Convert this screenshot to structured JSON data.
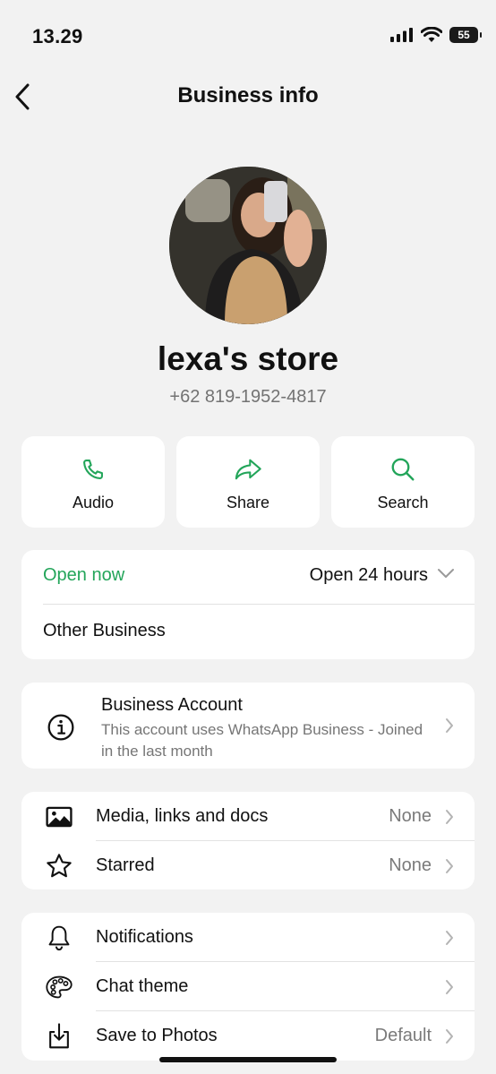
{
  "status_bar": {
    "time": "13.29",
    "battery": "55"
  },
  "nav": {
    "title": "Business info"
  },
  "profile": {
    "name": "lexa's store",
    "phone": "+62 819-1952-4817"
  },
  "actions": [
    {
      "label": "Audio",
      "icon": "phone-icon"
    },
    {
      "label": "Share",
      "icon": "share-arrow-icon"
    },
    {
      "label": "Search",
      "icon": "search-icon"
    }
  ],
  "hours_card": {
    "status": "Open now",
    "hours": "Open 24 hours",
    "category": "Other Business"
  },
  "business_account": {
    "title": "Business Account",
    "description": "This account uses WhatsApp Business - Joined in the last month"
  },
  "media_group": [
    {
      "label": "Media, links and docs",
      "value": "None",
      "icon": "image-icon"
    },
    {
      "label": "Starred",
      "value": "None",
      "icon": "star-icon"
    }
  ],
  "settings_group": [
    {
      "label": "Notifications",
      "value": "",
      "icon": "bell-icon"
    },
    {
      "label": "Chat theme",
      "value": "",
      "icon": "palette-icon"
    },
    {
      "label": "Save to Photos",
      "value": "Default",
      "icon": "download-icon"
    }
  ],
  "colors": {
    "accent_green": "#23a55a",
    "background": "#f2f2f2",
    "card": "#ffffff"
  }
}
